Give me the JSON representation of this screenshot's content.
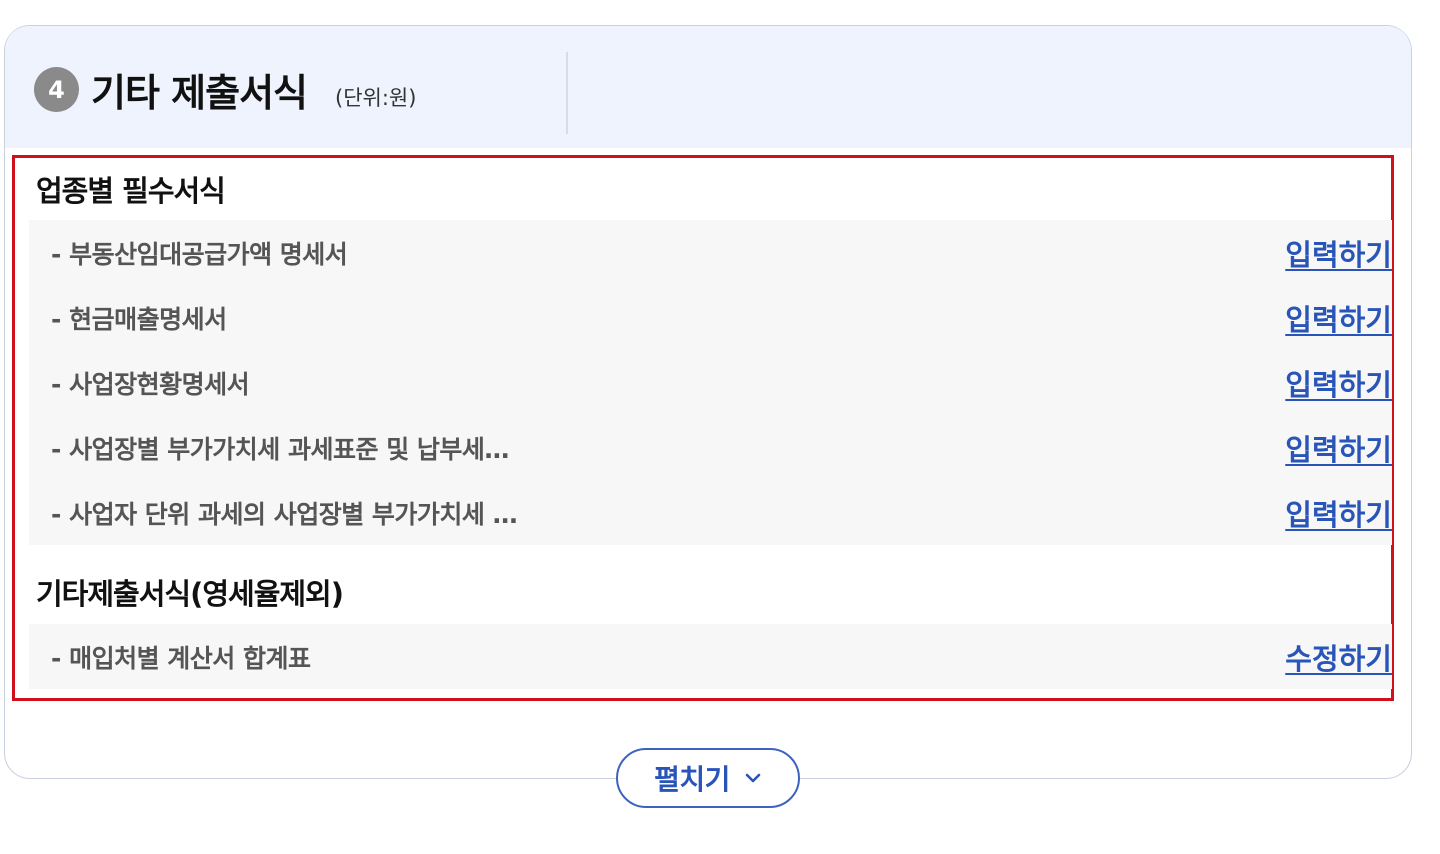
{
  "header": {
    "step_number": "4",
    "title": "기타 제출서식",
    "unit": "(단위:원)"
  },
  "groups": [
    {
      "title": "업종별 필수서식",
      "items": [
        {
          "label": "- 부동산임대공급가액 명세서",
          "action": "입력하기"
        },
        {
          "label": "- 현금매출명세서",
          "action": "입력하기"
        },
        {
          "label": "- 사업장현황명세서",
          "action": "입력하기"
        },
        {
          "label": "- 사업장별 부가가치세 과세표준 및 납부세…",
          "action": "입력하기"
        },
        {
          "label": "- 사업자 단위 과세의 사업장별 부가가치세 …",
          "action": "입력하기"
        }
      ]
    },
    {
      "title": "기타제출서식(영세율제외)",
      "items": [
        {
          "label": "- 매입처별 계산서 합계표",
          "action": "수정하기"
        }
      ]
    }
  ],
  "footer": {
    "expand_label": "펼치기",
    "expand_icon": "chevron-down-icon"
  },
  "colors": {
    "header_bg": "#eef3fd",
    "link": "#2a55b8",
    "highlight_border": "#d0101a",
    "row_bg": "#f7f7f7"
  }
}
